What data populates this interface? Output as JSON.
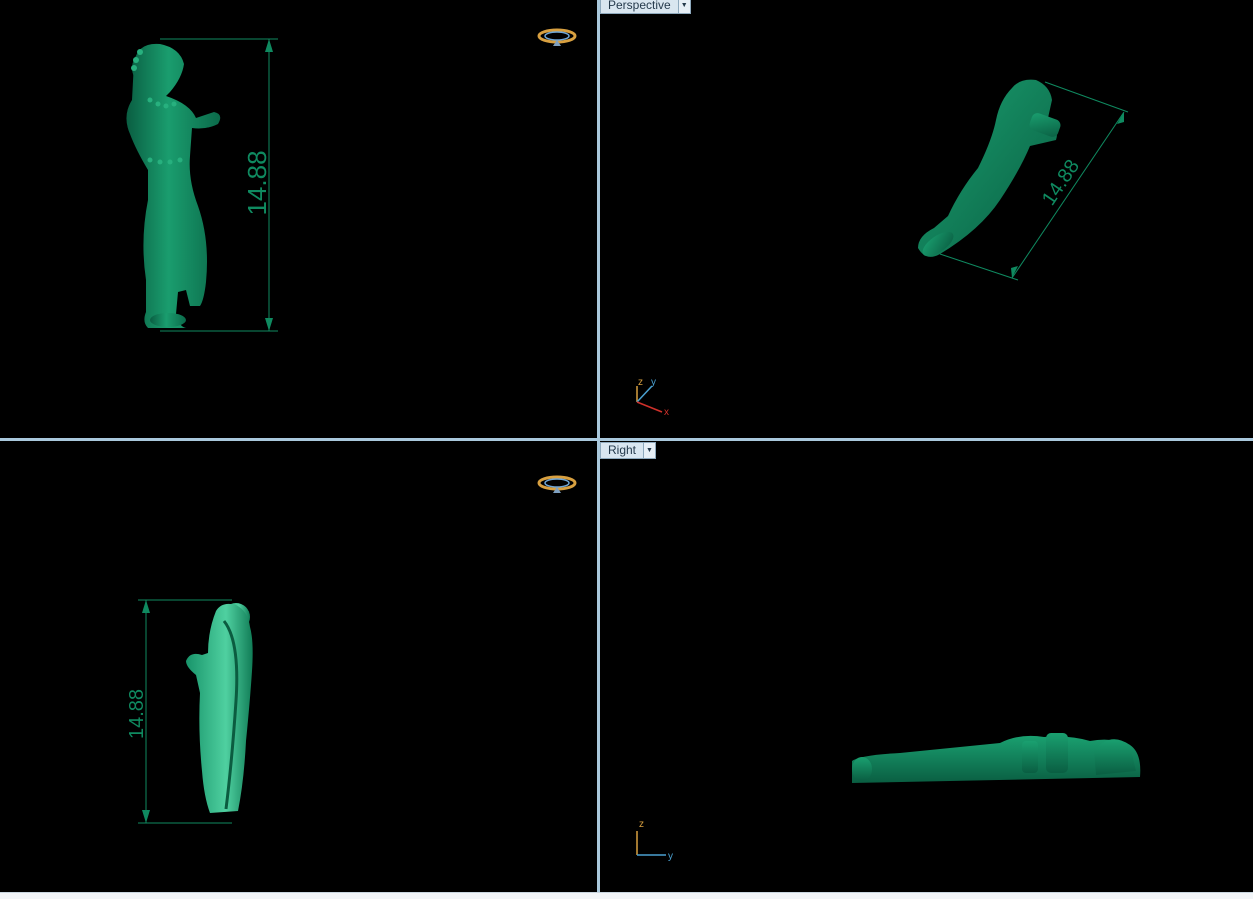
{
  "viewports": {
    "top_left": {
      "dimension": "14.88"
    },
    "top_right": {
      "label": "Perspective",
      "dimension": "14.88",
      "axes": {
        "z": "z",
        "y": "y",
        "x": "x"
      }
    },
    "bottom_left": {
      "dimension": "14.88"
    },
    "bottom_right": {
      "label": "Right",
      "axes": {
        "z": "z",
        "y": "y"
      }
    }
  },
  "icons": {
    "gizmo": "ring-gizmo-icon",
    "dropdown": "dropdown-arrow-icon"
  },
  "colors": {
    "model_green": "#10805a",
    "dimension_green": "#0f8a60",
    "divider": "#a9c8dc",
    "axis_x": "#d0302a",
    "axis_y": "#4aa0d0",
    "axis_z": "#d8a040"
  }
}
